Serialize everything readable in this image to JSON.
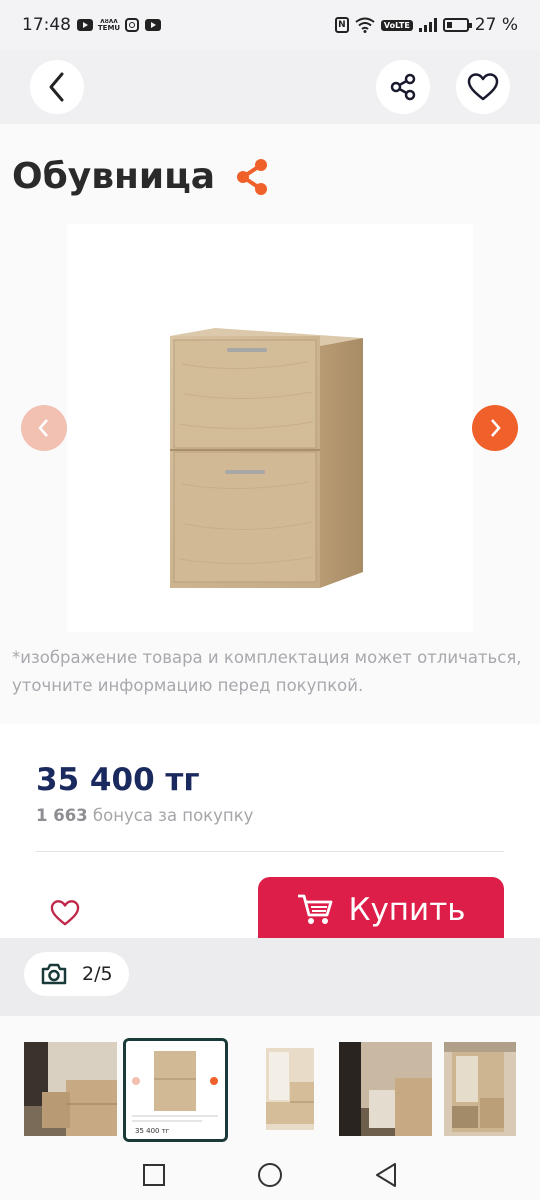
{
  "status_bar": {
    "time": "17:48",
    "temu_label": "ᴧᴕᴧᴧ\nTEMU",
    "volte": "VoLTE",
    "nfc": "N",
    "battery_percent": "27 %"
  },
  "nav": {
    "back_icon": "chevron-left-icon",
    "share_icon": "share-icon",
    "favorite_icon": "heart-icon"
  },
  "product": {
    "title": "Обувница",
    "disclaimer": "*изображение товара и комплектация может отличаться, уточните информацию перед покупкой.",
    "price": "35 400 тг",
    "bonus_amount": "1 663",
    "bonus_text": "бонуса за покупку",
    "buy_label": "Купить"
  },
  "viewer": {
    "counter": "2/5",
    "camera_icon": "camera-icon",
    "active_thumb_price": "35 400 тг"
  },
  "colors": {
    "accent_orange": "#f0602a",
    "buy_red": "#dc1e48",
    "price_navy": "#1b2a5e"
  }
}
